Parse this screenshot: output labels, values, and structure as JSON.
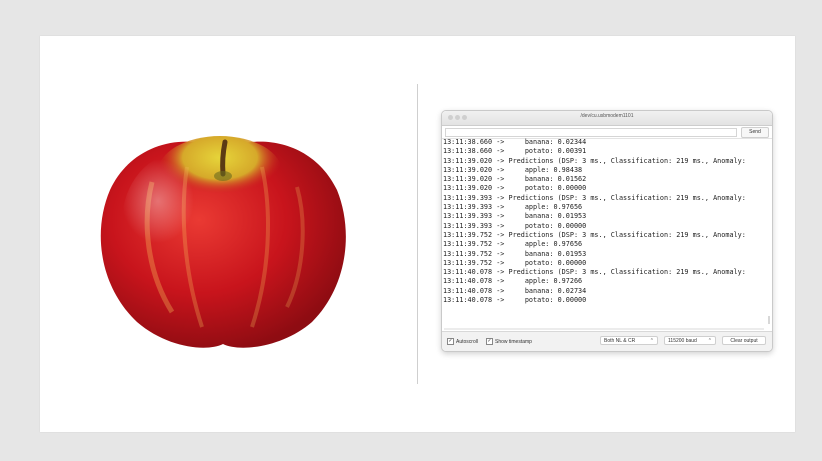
{
  "serial_monitor": {
    "title": "/dev/cu.usbmodem1101",
    "send_label": "Send",
    "lines": [
      "13:11:38.660 ->     banana: 0.02344",
      "13:11:38.660 ->     potato: 0.00391",
      "13:11:39.020 -> Predictions (DSP: 3 ms., Classification: 219 ms., Anomaly:",
      "13:11:39.020 ->     apple: 0.98438",
      "13:11:39.020 ->     banana: 0.01562",
      "13:11:39.020 ->     potato: 0.00000",
      "13:11:39.393 -> Predictions (DSP: 3 ms., Classification: 219 ms., Anomaly:",
      "13:11:39.393 ->     apple: 0.97656",
      "13:11:39.393 ->     banana: 0.01953",
      "13:11:39.393 ->     potato: 0.00000",
      "13:11:39.752 -> Predictions (DSP: 3 ms., Classification: 219 ms., Anomaly:",
      "13:11:39.752 ->     apple: 0.97656",
      "13:11:39.752 ->     banana: 0.01953",
      "13:11:39.752 ->     potato: 0.00000",
      "13:11:40.078 -> Predictions (DSP: 3 ms., Classification: 219 ms., Anomaly:",
      "13:11:40.078 ->     apple: 0.97266",
      "13:11:40.078 ->     banana: 0.02734",
      "13:11:40.078 ->     potato: 0.00000"
    ],
    "autoscroll_label": "Autoscroll",
    "timestamp_label": "Show timestamp",
    "line_ending": "Both NL & CR",
    "baud_rate": "115200 baud",
    "clear_label": "Clear output"
  },
  "colors": {
    "background": "#e6e6e6",
    "apple_red": "#c8141c",
    "apple_yellow": "#d6c22a"
  },
  "icons": [
    "apple-image",
    "close-dot-icon",
    "minimize-dot-icon",
    "zoom-dot-icon",
    "checkbox-icon",
    "chevron-icon"
  ]
}
